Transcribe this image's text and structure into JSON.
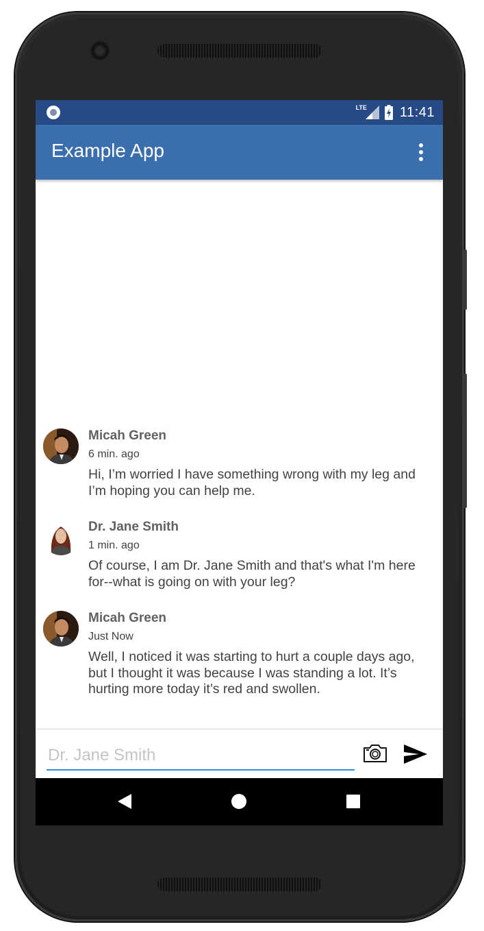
{
  "status_bar": {
    "network_label": "LTE",
    "time": "11:41"
  },
  "app_bar": {
    "title": "Example App",
    "overflow_icon": "more-vert-icon"
  },
  "messages": [
    {
      "sender": "Micah Green",
      "time": "6 min. ago",
      "text": "Hi, I’m worried I have something wrong with my leg and I’m hoping you can help me.",
      "avatar": "male-avatar"
    },
    {
      "sender": "Dr. Jane Smith",
      "time": "1 min. ago",
      "text": "Of course, I am Dr. Jane Smith and that's what I'm here for--what is going on with your leg?",
      "avatar": "female-avatar"
    },
    {
      "sender": "Micah Green",
      "time": "Just Now",
      "text": "Well, I noticed it was starting to hurt a couple days ago, but I thought it was because I was standing a lot. It’s hurting more today it’s red and swollen.",
      "avatar": "male-avatar"
    }
  ],
  "composer": {
    "placeholder": "Dr. Jane Smith",
    "value": "",
    "camera_icon": "camera-icon",
    "send_icon": "send-icon"
  },
  "nav_bar": {
    "icons": [
      "back-icon",
      "home-icon",
      "recents-icon"
    ]
  },
  "colors": {
    "status_bar": "#264a85",
    "app_bar": "#3a6eac",
    "input_underline": "#2f8fe0"
  }
}
